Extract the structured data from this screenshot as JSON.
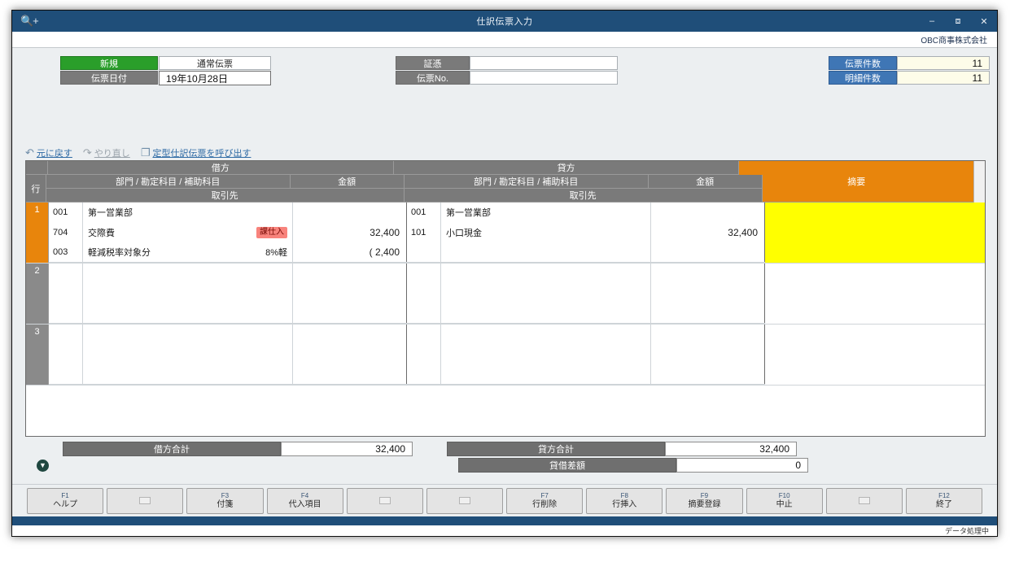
{
  "titlebar": {
    "search_icon": "search-plus-icon",
    "title": "仕訳伝票入力",
    "minimize": "–",
    "maximize": "⬜",
    "close": "✕"
  },
  "company": {
    "name": "OBC商事株式会社"
  },
  "topform": {
    "status_label": "新規",
    "voucher_type": "通常伝票",
    "date_label": "伝票日付",
    "date_value": "19年10月28日",
    "shohyo_label": "証憑",
    "shohyo_value": "",
    "denpyo_no_label": "伝票No.",
    "denpyo_no_value": "",
    "voucher_count_label": "伝票件数",
    "voucher_count_value": "11",
    "detail_count_label": "明細件数",
    "detail_count_value": "11"
  },
  "undobar": {
    "undo_icon": "↶",
    "undo_label": "元に戻す",
    "redo_icon": "↷",
    "redo_label": "やり直し",
    "template_icon": "❐",
    "template_label": "定型仕訳伝票を呼び出す"
  },
  "grid": {
    "row_header": "行",
    "debit_header": "借方",
    "credit_header": "貸方",
    "subheader_account": "部門 / 勘定科目 / 補助科目",
    "subheader_amount": "金額",
    "subheader_client": "取引先",
    "description_header": "摘要",
    "rows": [
      {
        "number": "1",
        "active": true,
        "debit": {
          "lines": [
            {
              "code": "001",
              "name": "第一営業部",
              "tax": "",
              "tax_style": "none",
              "amount": ""
            },
            {
              "code": "704",
              "name": "交際費",
              "tax": "課仕入",
              "tax_style": "badge",
              "amount": "32,400"
            },
            {
              "code": "003",
              "name": "軽減税率対象分",
              "tax": "8%軽",
              "tax_style": "plain",
              "amount": "( 2,400"
            }
          ],
          "client": ""
        },
        "credit": {
          "lines": [
            {
              "code": "001",
              "name": "第一営業部",
              "tax": "",
              "tax_style": "none",
              "amount": ""
            },
            {
              "code": "101",
              "name": "小口現金",
              "tax": "",
              "tax_style": "none",
              "amount": "32,400"
            },
            {
              "code": "",
              "name": "",
              "tax": "",
              "tax_style": "none",
              "amount": ""
            }
          ],
          "client": ""
        },
        "description": "",
        "note_icon": "comment-icon"
      },
      {
        "number": "2",
        "active": false,
        "debit": {
          "lines": [
            {
              "code": "",
              "name": "",
              "tax": "",
              "tax_style": "none",
              "amount": ""
            },
            {
              "code": "",
              "name": "",
              "tax": "",
              "tax_style": "none",
              "amount": ""
            },
            {
              "code": "",
              "name": "",
              "tax": "",
              "tax_style": "none",
              "amount": ""
            }
          ],
          "client": ""
        },
        "credit": {
          "lines": [
            {
              "code": "",
              "name": "",
              "tax": "",
              "tax_style": "none",
              "amount": ""
            },
            {
              "code": "",
              "name": "",
              "tax": "",
              "tax_style": "none",
              "amount": ""
            },
            {
              "code": "",
              "name": "",
              "tax": "",
              "tax_style": "none",
              "amount": ""
            }
          ],
          "client": ""
        },
        "description": "",
        "note_icon": ""
      },
      {
        "number": "3",
        "active": false,
        "debit": {
          "lines": [
            {
              "code": "",
              "name": "",
              "tax": "",
              "tax_style": "none",
              "amount": ""
            },
            {
              "code": "",
              "name": "",
              "tax": "",
              "tax_style": "none",
              "amount": ""
            },
            {
              "code": "",
              "name": "",
              "tax": "",
              "tax_style": "none",
              "amount": ""
            }
          ],
          "client": ""
        },
        "credit": {
          "lines": [
            {
              "code": "",
              "name": "",
              "tax": "",
              "tax_style": "none",
              "amount": ""
            },
            {
              "code": "",
              "name": "",
              "tax": "",
              "tax_style": "none",
              "amount": ""
            },
            {
              "code": "",
              "name": "",
              "tax": "",
              "tax_style": "none",
              "amount": ""
            }
          ],
          "client": ""
        },
        "description": "",
        "note_icon": ""
      }
    ],
    "scroll_up_icon": "˄",
    "scroll_down_icon": "˅"
  },
  "totals": {
    "expand_icon": "▼",
    "debit_total_label": "借方合計",
    "debit_total_value": "32,400",
    "credit_total_label": "貸方合計",
    "credit_total_value": "32,400",
    "balance_label": "貸借差額",
    "balance_value": "0"
  },
  "function_keys": [
    {
      "key": "F1",
      "label": "ヘルプ",
      "empty": false
    },
    {
      "key": "",
      "label": "",
      "empty": true
    },
    {
      "key": "F3",
      "label": "付箋",
      "empty": false
    },
    {
      "key": "F4",
      "label": "代入項目",
      "empty": false
    },
    {
      "key": "",
      "label": "",
      "empty": true
    },
    {
      "key": "",
      "label": "",
      "empty": true
    },
    {
      "key": "F7",
      "label": "行削除",
      "empty": false
    },
    {
      "key": "F8",
      "label": "行挿入",
      "empty": false
    },
    {
      "key": "F9",
      "label": "摘要登録",
      "empty": false
    },
    {
      "key": "F10",
      "label": "中止",
      "empty": false
    },
    {
      "key": "",
      "label": "",
      "empty": true
    },
    {
      "key": "F12",
      "label": "終了",
      "empty": false
    }
  ],
  "statusbar": {
    "text": "データ処理中"
  },
  "colors": {
    "title_blue": "#1f4e79",
    "accent_orange": "#e8850c",
    "new_green": "#2a9e2a",
    "label_gray": "#7a7a7a",
    "count_blue": "#3f76b5",
    "active_yellow": "#ffff00",
    "tax_badge_red": "#f8837c"
  }
}
